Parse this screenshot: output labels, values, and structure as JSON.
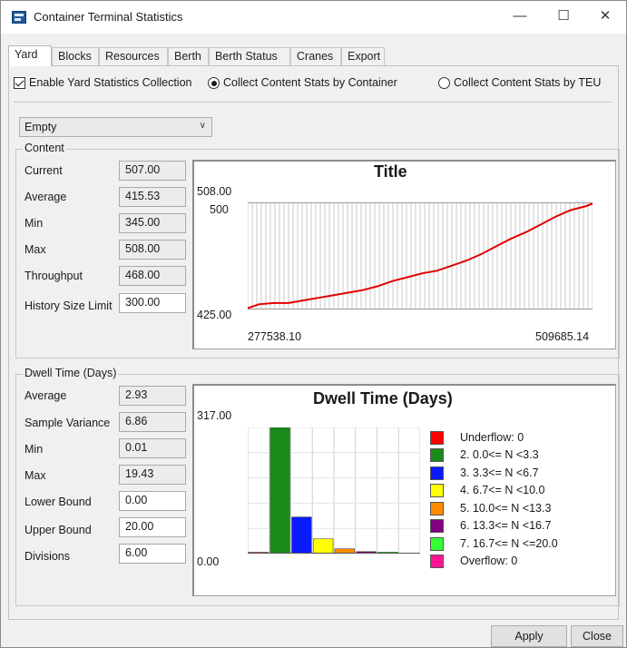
{
  "window": {
    "title": "Container Terminal Statistics",
    "controls": {
      "minimize": "—",
      "maximize": "☐",
      "close": "✕"
    }
  },
  "tabs": [
    "Yard",
    "Blocks",
    "Resources",
    "Berth",
    "Berth Status",
    "Cranes",
    "Export"
  ],
  "options": {
    "enable_label": "Enable Yard Statistics Collection",
    "enable_checked": true,
    "by_container_label": "Collect Content Stats by Container",
    "by_container_selected": true,
    "by_teu_label": "Collect Content Stats by TEU",
    "by_teu_selected": false
  },
  "dropdown": {
    "value": "Empty"
  },
  "content": {
    "group_title": "Content",
    "fields": {
      "current": {
        "label": "Current",
        "value": "507.00"
      },
      "average": {
        "label": "Average",
        "value": "415.53"
      },
      "min": {
        "label": "Min",
        "value": "345.00"
      },
      "max": {
        "label": "Max",
        "value": "508.00"
      },
      "throughput": {
        "label": "Throughput",
        "value": "468.00"
      },
      "history": {
        "label": "History Size Limit",
        "value": "300.00"
      }
    },
    "chart": {
      "title": "Title",
      "y_max_label": "508.00",
      "y_mid_label": "500",
      "y_min_label": "425.00",
      "x_min_label": "277538.10",
      "x_max_label": "509685.14"
    }
  },
  "dwell": {
    "group_title": "Dwell Time (Days)",
    "fields": {
      "average": {
        "label": "Average",
        "value": "2.93"
      },
      "variance": {
        "label": "Sample Variance",
        "value": "6.86"
      },
      "min": {
        "label": "Min",
        "value": "0.01"
      },
      "max": {
        "label": "Max",
        "value": "19.43"
      },
      "lower": {
        "label": "Lower Bound",
        "value": "0.00"
      },
      "upper": {
        "label": "Upper Bound",
        "value": "20.00"
      },
      "divisions": {
        "label": "Divisions",
        "value": "6.00"
      }
    },
    "chart": {
      "title": "Dwell Time (Days)",
      "y_max_label": "317.00",
      "y_min_label": "0.00"
    }
  },
  "colors": {
    "line": "#e00000",
    "underflow": "#ff0000",
    "bin2": "#1a8a1a",
    "bin3": "#0a1aff",
    "bin4": "#ffff00",
    "bin5": "#ff8c00",
    "bin6": "#800080",
    "bin7": "#33ff33",
    "overflow": "#ff1493"
  },
  "buttons": {
    "apply": "Apply",
    "close": "Close"
  },
  "chart_data": [
    {
      "type": "line",
      "title": "Title",
      "xlim": [
        277538.1,
        509685.14
      ],
      "ylim": [
        425.0,
        508.0
      ],
      "series": [
        {
          "x": [
            277538.1,
            285000,
            295000,
            305000,
            315000,
            325000,
            335000,
            345000,
            355000,
            365000,
            375000,
            385000,
            395000,
            405000,
            415000,
            425000,
            435000,
            445000,
            455000,
            465000,
            475000,
            485000,
            495000,
            505000,
            509685.14
          ],
          "values": [
            426,
            429,
            430,
            430,
            432,
            434,
            436,
            438,
            440,
            443,
            447,
            450,
            453,
            455,
            459,
            463,
            468,
            474,
            480,
            485,
            491,
            497,
            502,
            505,
            507
          ]
        }
      ],
      "grid": true
    },
    {
      "type": "bar",
      "title": "Dwell Time (Days)",
      "ylim": [
        0.0,
        317.0
      ],
      "categories": [
        "Underflow: 0",
        "2. 0.0<= N <3.3",
        "3. 3.3<= N <6.7",
        "4. 6.7<= N <10.0",
        "5. 10.0<= N <13.3",
        "6. 13.3<= N <16.7",
        "7. 16.7<= N <=20.0",
        "Overflow: 0"
      ],
      "values": [
        0,
        317,
        92,
        37,
        12,
        5,
        4,
        0
      ],
      "legend": "right",
      "grid": true
    }
  ]
}
